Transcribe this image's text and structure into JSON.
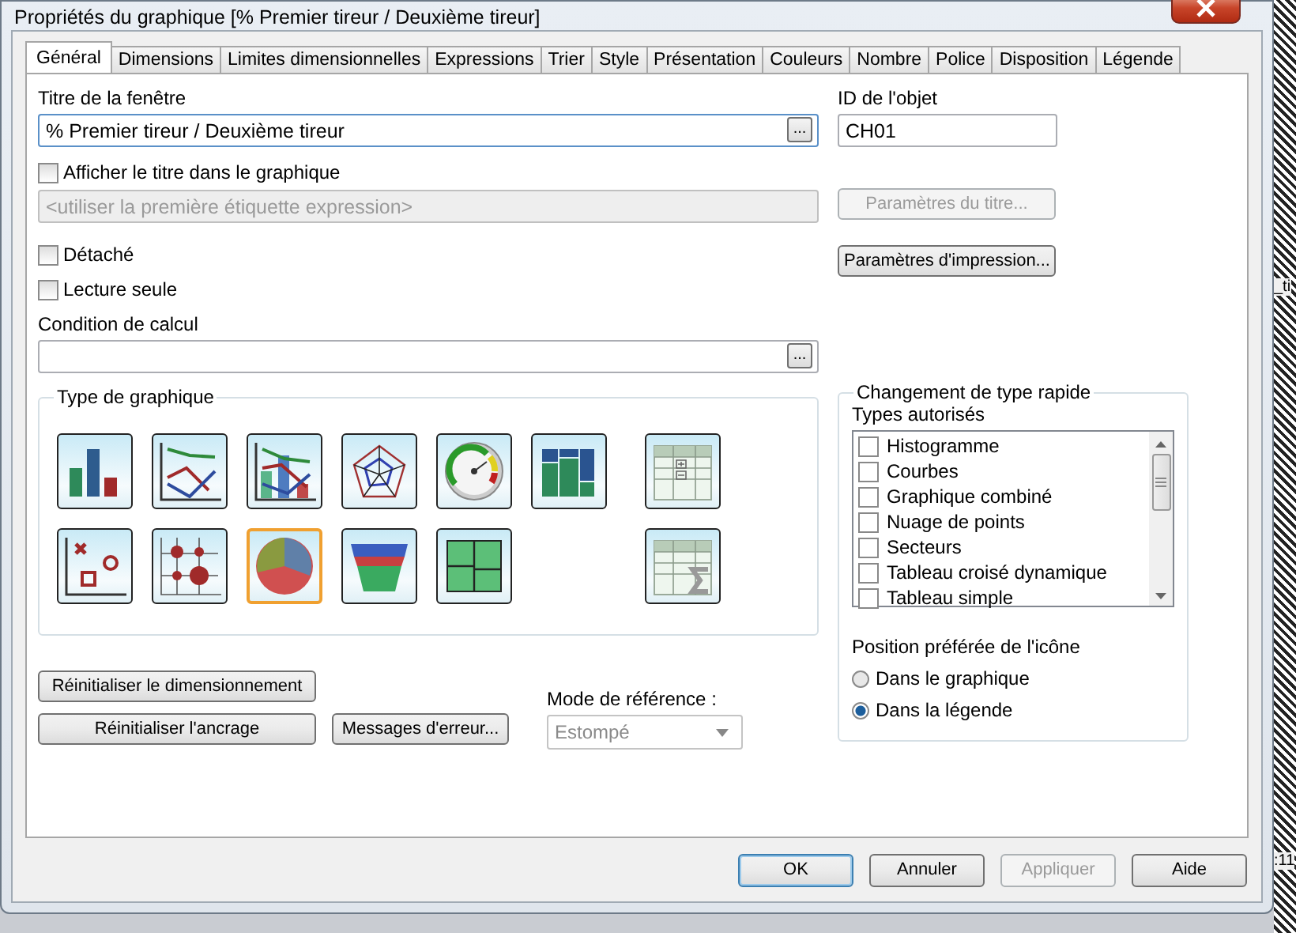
{
  "window": {
    "title": "Propriétés du graphique [% Premier tireur / Deuxième tireur]"
  },
  "tabs": [
    {
      "label": "Général",
      "selected": true
    },
    {
      "label": "Dimensions",
      "selected": false
    },
    {
      "label": "Limites dimensionnelles",
      "selected": false
    },
    {
      "label": "Expressions",
      "selected": false
    },
    {
      "label": "Trier",
      "selected": false
    },
    {
      "label": "Style",
      "selected": false
    },
    {
      "label": "Présentation",
      "selected": false
    },
    {
      "label": "Couleurs",
      "selected": false
    },
    {
      "label": "Nombre",
      "selected": false
    },
    {
      "label": "Police",
      "selected": false
    },
    {
      "label": "Disposition",
      "selected": false
    },
    {
      "label": "Légende",
      "selected": false
    }
  ],
  "window_title_field": {
    "label": "Titre de la fenêtre",
    "value": "% Premier tireur / Deuxième tireur",
    "button": "..."
  },
  "object_id": {
    "label": "ID de l'objet",
    "value": "CH01"
  },
  "show_title": {
    "label": "Afficher le titre dans le graphique",
    "checked": false
  },
  "title_text_field": {
    "placeholder": "<utiliser la première étiquette expression>",
    "disabled": true
  },
  "title_settings_button": {
    "label": "Paramètres du titre...",
    "disabled": true
  },
  "print_settings_button": {
    "label": "Paramètres d'impression...",
    "disabled": false
  },
  "options": [
    {
      "label": "Détaché",
      "checked": false
    },
    {
      "label": "Lecture seule",
      "checked": false
    }
  ],
  "calc_condition": {
    "label": "Condition de calcul",
    "button": "..."
  },
  "chart_type": {
    "title": "Type de graphique",
    "types": [
      {
        "kind": "bar",
        "selected": false
      },
      {
        "kind": "line",
        "selected": false
      },
      {
        "kind": "combo",
        "selected": false
      },
      {
        "kind": "radar",
        "selected": false
      },
      {
        "kind": "gauge",
        "selected": false
      },
      {
        "kind": "mekko",
        "selected": false
      },
      {
        "kind": "pivot",
        "selected": false
      },
      {
        "kind": "scatter",
        "selected": false
      },
      {
        "kind": "grid",
        "selected": false
      },
      {
        "kind": "pie",
        "selected": true
      },
      {
        "kind": "funnel",
        "selected": false
      },
      {
        "kind": "block",
        "selected": false
      },
      {
        "kind": "straight",
        "selected": false
      }
    ]
  },
  "quick_change": {
    "title": "Changement de type rapide",
    "allowed_label": "Types autorisés",
    "allowed": [
      {
        "label": "Histogramme",
        "checked": false
      },
      {
        "label": "Courbes",
        "checked": false
      },
      {
        "label": "Graphique combiné",
        "checked": false
      },
      {
        "label": "Nuage de points",
        "checked": false
      },
      {
        "label": "Secteurs",
        "checked": false
      },
      {
        "label": "Tableau croisé dynamique",
        "checked": false
      },
      {
        "label": "Tableau simple",
        "checked": false
      }
    ],
    "position_label": "Position préférée de l'icône",
    "positions": [
      {
        "label": "Dans le graphique",
        "selected": false
      },
      {
        "label": "Dans la légende",
        "selected": true
      }
    ]
  },
  "reset_buttons": [
    "Réinitialiser le dimensionnement",
    "Réinitialiser l'ancrage"
  ],
  "error_messages_button": "Messages d'erreur...",
  "reference_mode": {
    "label": "Mode de référence :",
    "value": "Estompé",
    "disabled": true
  },
  "footer_buttons": [
    {
      "label": "OK",
      "default": true,
      "disabled": false
    },
    {
      "label": "Annuler",
      "default": false,
      "disabled": false
    },
    {
      "label": "Appliquer",
      "default": false,
      "disabled": true
    },
    {
      "label": "Aide",
      "default": false,
      "disabled": false
    }
  ],
  "background_texts": [
    "_ti",
    ":11"
  ]
}
